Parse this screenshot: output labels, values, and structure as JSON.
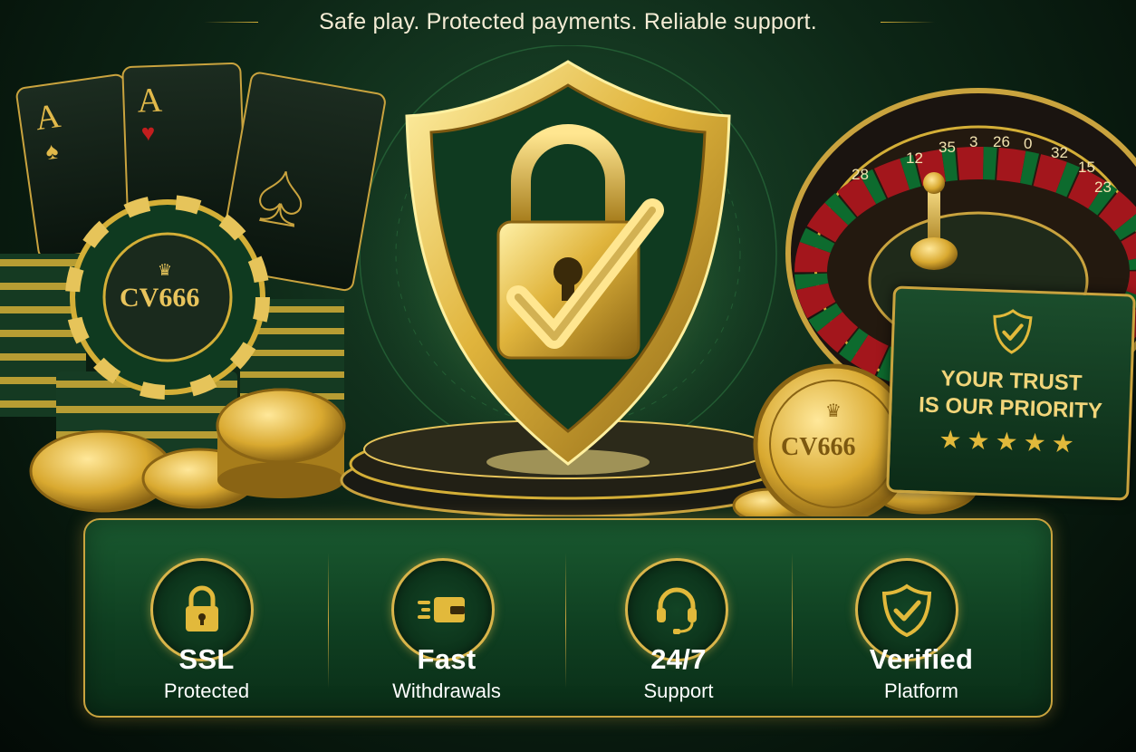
{
  "tagline": "Safe play. Protected payments. Reliable support.",
  "brand": {
    "chip_text": "CV666",
    "coin_text": "CV666"
  },
  "cards": {
    "card1_rank": "A",
    "card2_rank": "A"
  },
  "trust_card": {
    "line1": "YOUR TRUST",
    "line2": "IS OUR PRIORITY",
    "stars": "★★★★★"
  },
  "features": [
    {
      "title": "SSL",
      "subtitle": "Protected",
      "icon": "padlock-icon"
    },
    {
      "title": "Fast",
      "subtitle": "Withdrawals",
      "icon": "wallet-fast-icon"
    },
    {
      "title": "24/7",
      "subtitle": "Support",
      "icon": "headset-icon"
    },
    {
      "title": "Verified",
      "subtitle": "Platform",
      "icon": "shield-check-icon"
    }
  ],
  "roulette_numbers": [
    "28",
    "12",
    "35",
    "3",
    "26",
    "0",
    "32",
    "15",
    "23"
  ],
  "colors": {
    "gold": "#d4af37",
    "green_dark": "#0d2616",
    "green_panel": "#1a5a30",
    "roulette_red": "#a3161c"
  }
}
